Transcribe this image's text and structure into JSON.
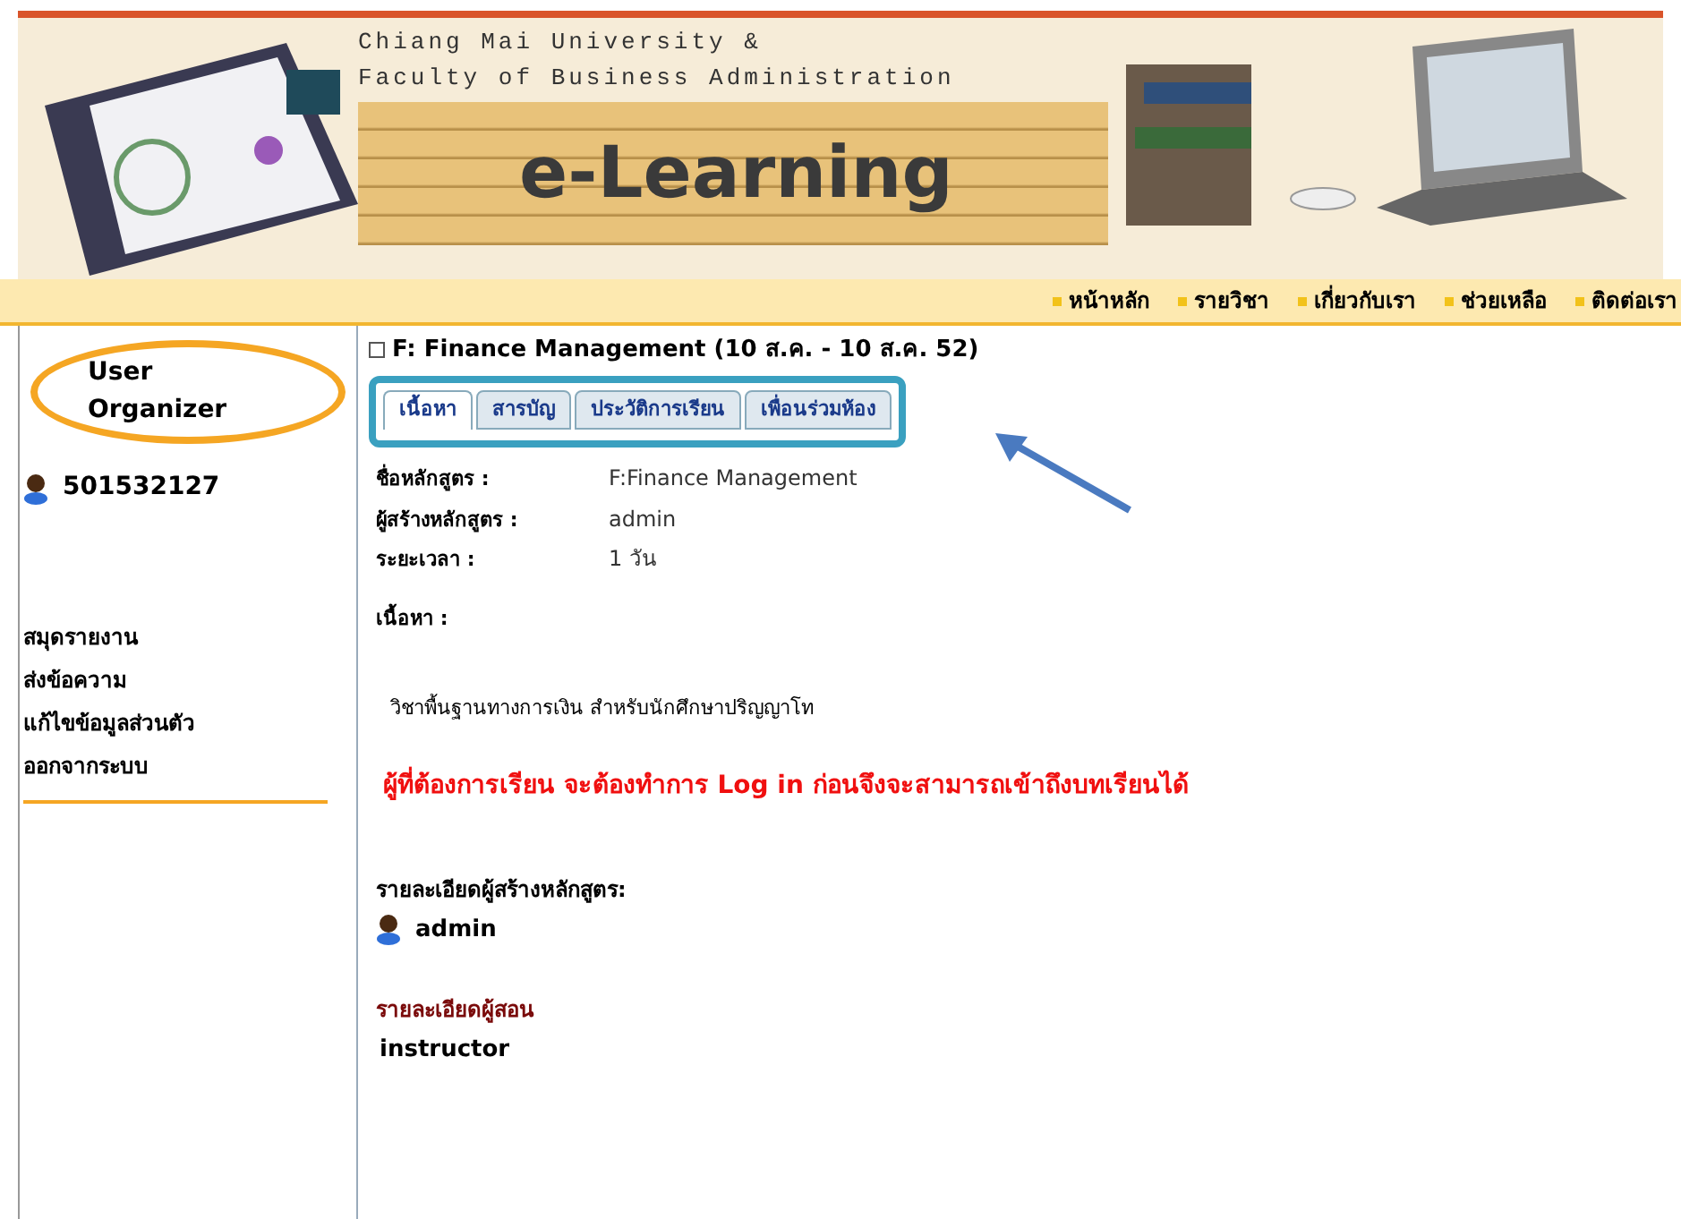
{
  "header": {
    "org_line_1": "Chiang Mai University &",
    "org_line_2": "Faculty of Business Administration",
    "title": "e-Learning"
  },
  "nav": [
    "หน้าหลัก",
    "รายวิชา",
    "เกี่ยวกับเรา",
    "ช่วยเหลือ",
    "ติดต่อเรา"
  ],
  "sidebar": {
    "title": "User Organizer",
    "user_id": "501532127",
    "menu": [
      "สมุดรายงาน",
      "ส่งข้อความ",
      "แก้ไขข้อมูลส่วนตัว",
      "ออกจากระบบ"
    ]
  },
  "course": {
    "title": "F: Finance Management (10 ส.ค. - 10 ส.ค. 52)",
    "tabs": [
      {
        "label": "เนื้อหา",
        "selected": true
      },
      {
        "label": "สารบัญ",
        "selected": false
      },
      {
        "label": "ประวัติการเรียน",
        "selected": false
      },
      {
        "label": "เพื่อนร่วมห้อง",
        "selected": false
      }
    ],
    "fields": [
      {
        "label": "ชื่อหลักสูตร :",
        "value": "F:Finance Management"
      },
      {
        "label": "ผู้สร้างหลักสูตร :",
        "value": "admin"
      },
      {
        "label": "ระยะเวลา :",
        "value": "1 วัน"
      }
    ],
    "content_label": "เนื้อหา :",
    "description": "วิชาพื้นฐานทางการเงิน สำหรับนักศึกษาปริญญาโท",
    "notice": "ผู้ที่ต้องการเรียน จะต้องทำการ Log in ก่อนจึงจะสามารถเข้าถึงบทเรียนได้",
    "creator_heading": "รายละเอียดผู้สร้างหลักสูตร:",
    "creator": "admin",
    "instructor_heading": "รายละเอียดผู้สอน",
    "instructor": "instructor"
  }
}
